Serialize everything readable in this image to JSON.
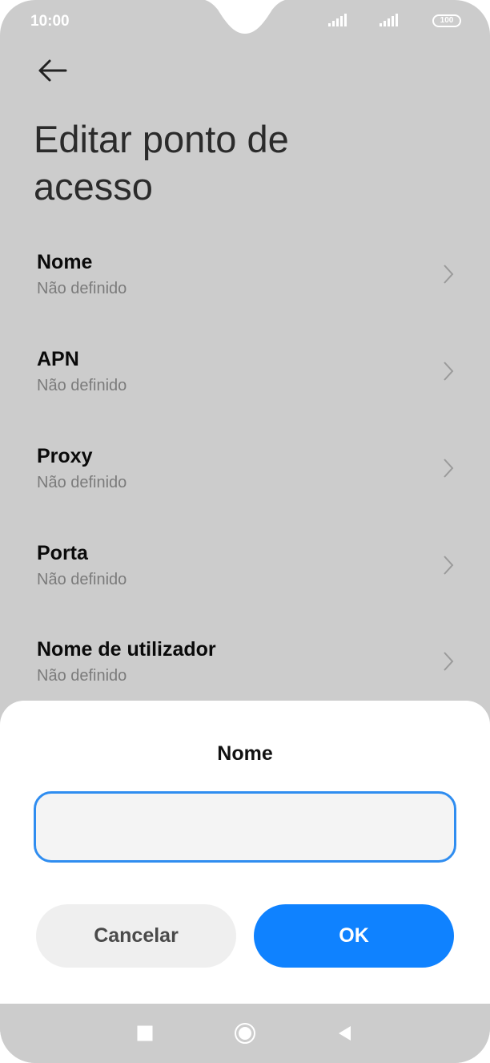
{
  "status_bar": {
    "time": "10:00",
    "battery": "100"
  },
  "header": {
    "back_icon": "arrow-left-icon",
    "title": "Editar ponto de acesso"
  },
  "settings": {
    "items": [
      {
        "label": "Nome",
        "value": "Não definido"
      },
      {
        "label": "APN",
        "value": "Não definido"
      },
      {
        "label": "Proxy",
        "value": "Não definido"
      },
      {
        "label": "Porta",
        "value": "Não definido"
      },
      {
        "label": "Nome de utilizador",
        "value": "Não definido"
      }
    ]
  },
  "dialog": {
    "title": "Nome",
    "input_value": "",
    "cancel_label": "Cancelar",
    "ok_label": "OK"
  },
  "nav": {
    "recents_icon": "square-icon",
    "home_icon": "circle-icon",
    "back_icon": "triangle-back-icon"
  },
  "colors": {
    "overlay": "#cccccc",
    "accent": "#0f82ff",
    "input_border": "#2f8df0"
  }
}
